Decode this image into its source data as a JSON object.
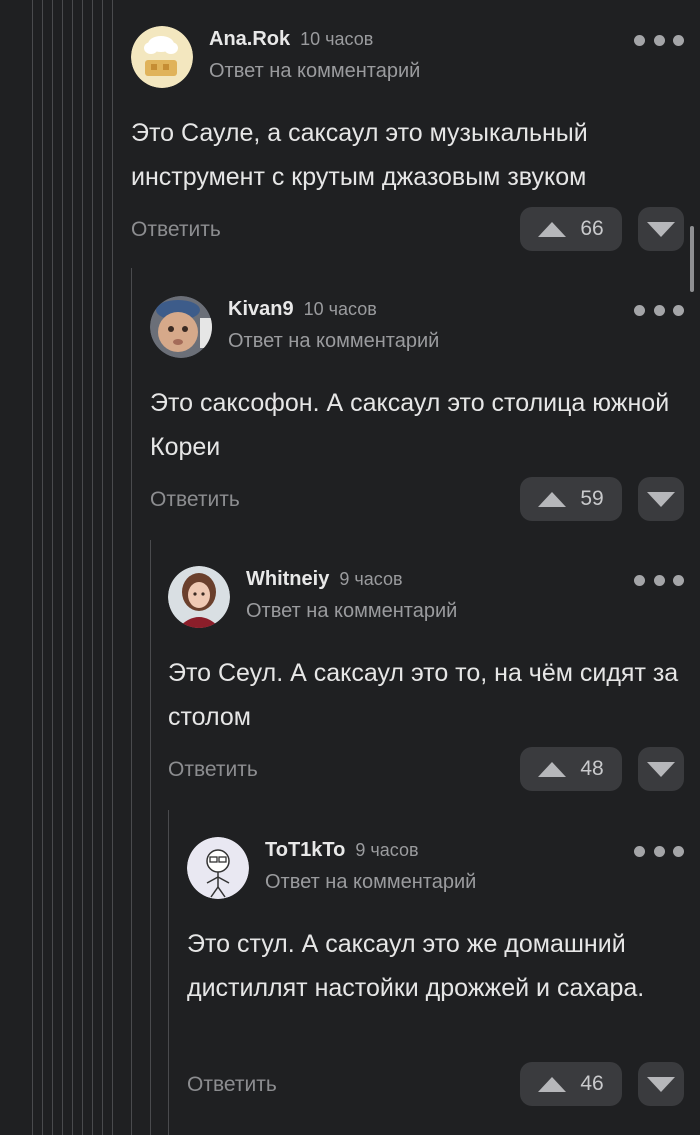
{
  "reply_to_label": "Ответ на комментарий",
  "reply_button_label": "Ответить",
  "comments": [
    {
      "author": "Ana.Rok",
      "time": "10 часов",
      "text": "Это Сауле, а саксаул это музыкальный инструмент с крутым джазовым звуком",
      "rating": "66"
    },
    {
      "author": "Kivan9",
      "time": "10 часов",
      "text": "Это саксофон. А саксаул это столица южной Кореи",
      "rating": "59"
    },
    {
      "author": "Whitneiy",
      "time": "9 часов",
      "text": "Это Сеул. А саксаул это то, на чём сидят за столом",
      "rating": "48"
    },
    {
      "author": "ToT1kTo",
      "time": "9 часов",
      "text": "Это стул. А саксаул это же домашний дистиллят настойки дрожжей и сахара.",
      "rating": "46"
    }
  ],
  "icons": {
    "more": "more-dots-icon",
    "upvote": "upvote-triangle-icon",
    "downvote": "downvote-triangle-icon"
  }
}
